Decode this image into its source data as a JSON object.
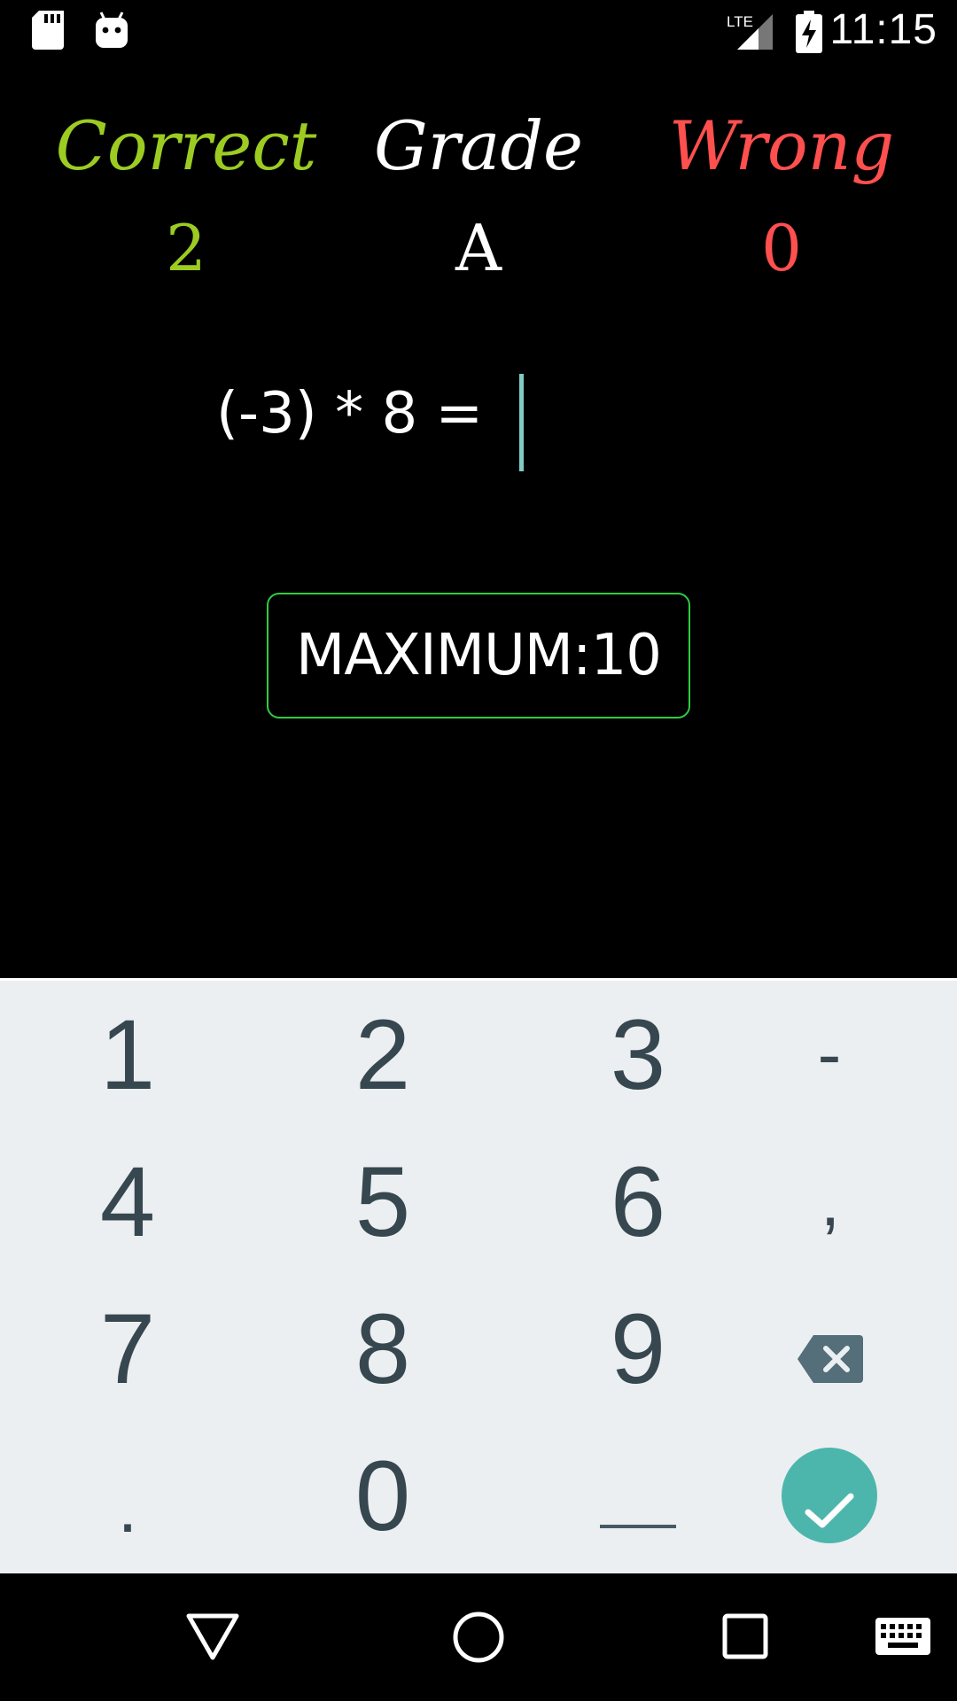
{
  "status_bar": {
    "time": "11:15",
    "left_icons": [
      "sd-card-icon",
      "android-icon"
    ],
    "network_label": "LTE",
    "right_icons": [
      "lte-signal-icon",
      "battery-charging-icon"
    ]
  },
  "scoreboard": {
    "correct_label": "Correct",
    "correct_value": "2",
    "grade_label": "Grade",
    "grade_value": "A",
    "wrong_label": "Wrong",
    "wrong_value": "0",
    "colors": {
      "correct": "#9ccc22",
      "grade": "#ffffff",
      "wrong": "#ff4f4f"
    }
  },
  "question": {
    "text": "(-3) * 8 =",
    "answer_value": ""
  },
  "maximum_button": {
    "label": "MAXIMUM:10",
    "border_color": "#2ecc40"
  },
  "keyboard": {
    "keys": [
      "1",
      "2",
      "3",
      "-",
      "4",
      "5",
      "6",
      ",",
      "7",
      "8",
      "9",
      "backspace",
      ".",
      "0",
      "_",
      "confirm"
    ],
    "key_1": "1",
    "key_2": "2",
    "key_3": "3",
    "key_minus": "-",
    "key_4": "4",
    "key_5": "5",
    "key_6": "6",
    "key_comma": ",",
    "key_7": "7",
    "key_8": "8",
    "key_9": "9",
    "key_dot": ".",
    "key_0": "0",
    "backspace_icon": "backspace-icon",
    "space_icon": "space-bar-icon",
    "confirm_icon": "check-icon",
    "confirm_color": "#4db6ac"
  },
  "nav_bar": {
    "buttons": [
      "back-icon",
      "home-icon",
      "recents-icon",
      "keyboard-switch-icon"
    ]
  }
}
